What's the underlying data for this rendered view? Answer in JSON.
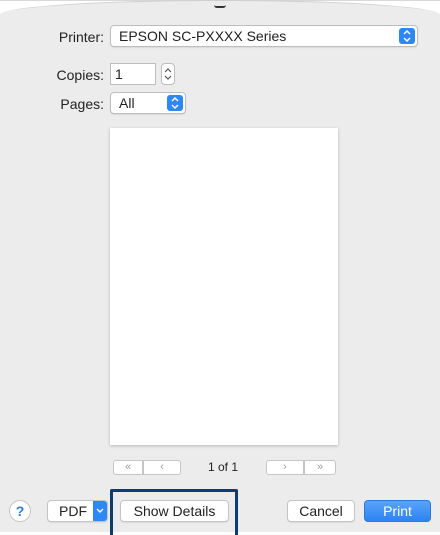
{
  "printer": {
    "label": "Printer:",
    "selected": "EPSON SC-PXXXX Series"
  },
  "copies": {
    "label": "Copies:",
    "value": "1"
  },
  "pages": {
    "label": "Pages:",
    "selected": "All"
  },
  "preview": {
    "page_indicator": "1 of 1",
    "first_label": "«",
    "prev_label": "‹",
    "next_label": "›",
    "last_label": "»"
  },
  "footer": {
    "help_label": "?",
    "pdf_label": "PDF",
    "show_details_label": "Show Details",
    "cancel_label": "Cancel",
    "print_label": "Print"
  },
  "colors": {
    "accent": "#2d87f5",
    "highlight": "#0a3d73",
    "background": "#ececec"
  },
  "icons": {
    "popup": "up-down-arrows-icon",
    "stepper": "stepper-arrows-icon",
    "pdf_menu": "chevron-down-icon"
  }
}
